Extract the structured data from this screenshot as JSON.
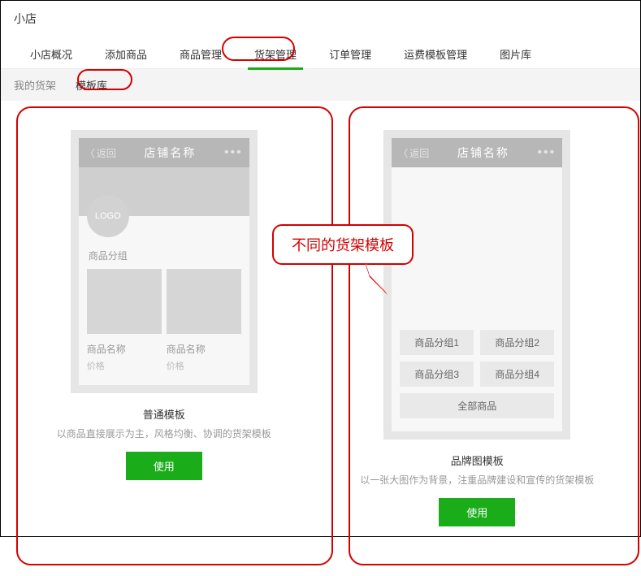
{
  "page_title": "小店",
  "main_tabs": [
    "小店概况",
    "添加商品",
    "商品管理",
    "货架管理",
    "订单管理",
    "运费模板管理",
    "图片库"
  ],
  "main_tab_active_index": 3,
  "sub_tabs": [
    "我的货架",
    "模板库"
  ],
  "sub_tab_active_index": 1,
  "callout_text": "不同的货架模板",
  "templates": [
    {
      "phone": {
        "back_label": "返回",
        "shop_name": "店铺名称",
        "logo_text": "LOGO",
        "group_label": "商品分组",
        "products": [
          {
            "name": "商品名称",
            "price": "价格"
          },
          {
            "name": "商品名称",
            "price": "价格"
          }
        ]
      },
      "title": "普通模板",
      "desc": "以商品直接展示为主，风格均衡、协调的货架模板",
      "use_label": "使用"
    },
    {
      "phone": {
        "back_label": "返回",
        "shop_name": "店铺名称",
        "group_buttons": [
          "商品分组1",
          "商品分组2",
          "商品分组3",
          "商品分组4"
        ],
        "all_label": "全部商品"
      },
      "title": "品牌图模板",
      "desc": "以一张大图作为背景，注重品牌建设和宣传的货架模板",
      "use_label": "使用"
    }
  ]
}
